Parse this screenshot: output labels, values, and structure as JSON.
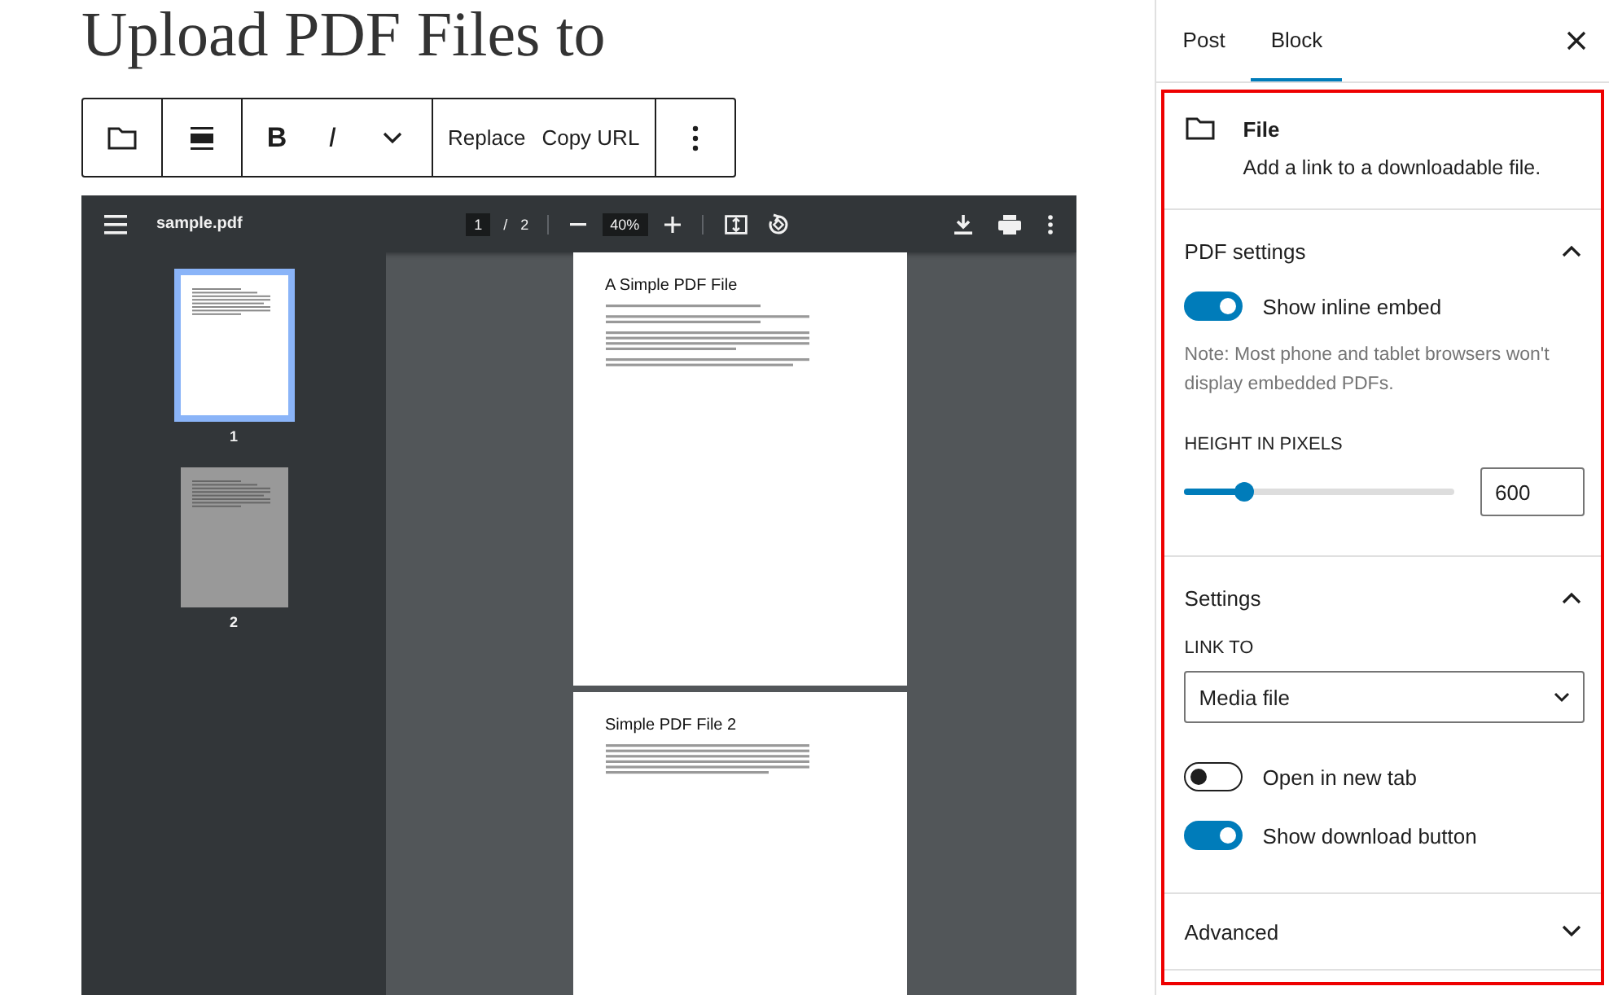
{
  "post_title": "Upload PDF Files to",
  "block_toolbar": {
    "tools": [
      {
        "kind": "folder"
      },
      {
        "kind": "align"
      },
      {
        "kind": "bold",
        "label": "B"
      },
      {
        "kind": "italic",
        "label": "I"
      },
      {
        "kind": "chevron"
      },
      {
        "kind": "text",
        "label": "Replace"
      },
      {
        "kind": "text",
        "label": "Copy URL"
      },
      {
        "kind": "more"
      }
    ]
  },
  "pdf_viewer": {
    "file_name": "sample.pdf",
    "current_page": "1",
    "page_separator": "/",
    "page_total": "2",
    "zoom": "40%",
    "thumbnails": [
      {
        "label": "1",
        "selected": true
      },
      {
        "label": "2",
        "selected": false
      }
    ],
    "pages": [
      {
        "heading": "A Simple PDF File"
      },
      {
        "heading": "Simple PDF File 2"
      }
    ]
  },
  "sidebar": {
    "tabs": [
      {
        "label": "Post",
        "selected": false
      },
      {
        "label": "Block",
        "selected": true
      }
    ],
    "block_card": {
      "title": "File",
      "description": "Add a link to a downloadable file."
    },
    "panels": [
      {
        "title": "PDF settings",
        "expanded": true,
        "controls": [
          {
            "kind": "toggle",
            "label": "Show inline embed",
            "on": true
          },
          {
            "kind": "note",
            "text": "Note: Most phone and tablet browsers won't display embedded PDFs."
          },
          {
            "kind": "range",
            "label": "HEIGHT IN PIXELS",
            "level": 0.22,
            "value": "600"
          }
        ]
      },
      {
        "title": "Settings",
        "expanded": true,
        "controls": [
          {
            "kind": "select",
            "label": "LINK TO",
            "value": "Media file"
          },
          {
            "kind": "toggle",
            "label": "Open in new tab",
            "on": false
          },
          {
            "kind": "toggle",
            "label": "Show download button",
            "on": true
          }
        ]
      },
      {
        "title": "Advanced",
        "expanded": false
      }
    ]
  }
}
